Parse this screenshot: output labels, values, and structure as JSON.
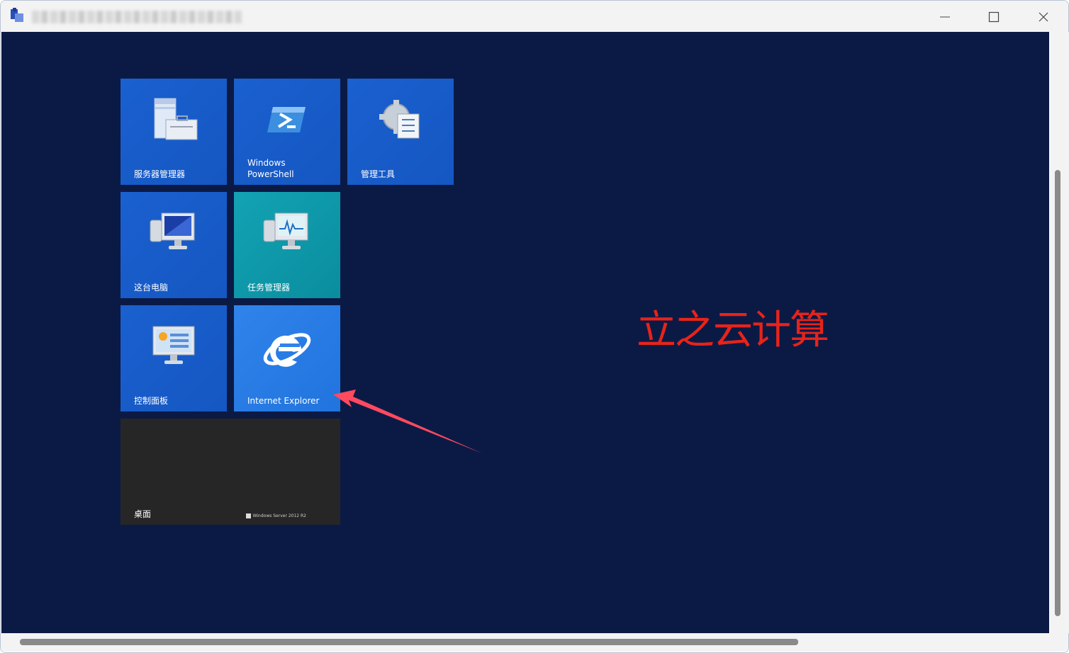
{
  "window": {
    "controls": {
      "minimize": "minimize-icon",
      "maximize": "maximize-icon",
      "close": "close-icon"
    }
  },
  "tiles": {
    "server_manager": {
      "label": "服务器管理器",
      "icon": "server-manager-icon"
    },
    "powershell": {
      "label": "Windows\nPowerShell",
      "icon": "powershell-icon"
    },
    "admin_tools": {
      "label": "管理工具",
      "icon": "admin-tools-icon"
    },
    "this_pc": {
      "label": "这台电脑",
      "icon": "computer-icon"
    },
    "task_manager": {
      "label": "任务管理器",
      "icon": "task-manager-icon"
    },
    "control_panel": {
      "label": "控制面板",
      "icon": "control-panel-icon"
    },
    "ie": {
      "label": "Internet Explorer",
      "icon": "internet-explorer-icon"
    },
    "desktop": {
      "label": "桌面",
      "brand": "Windows Server 2012 R2"
    }
  },
  "watermark": {
    "text": "立之云计算",
    "color": "#e8231a"
  },
  "colors": {
    "screen_bg": "#0b1a45",
    "tile_blue": "#1a60cf",
    "tile_teal": "#12a3b4",
    "tile_ie": "#2f83ea",
    "tile_desktop": "#262626",
    "arrow": "#ff4a5f"
  }
}
